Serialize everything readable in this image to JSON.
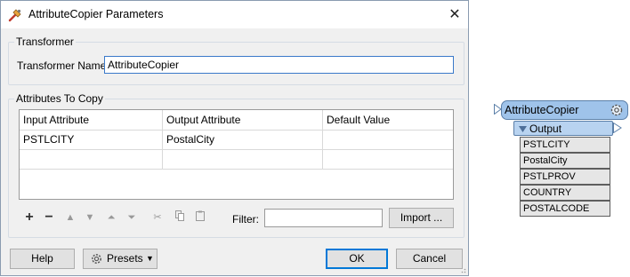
{
  "dialog": {
    "title": "AttributeCopier Parameters",
    "close_symbol": "✕",
    "transformer_group": {
      "label": "Transformer",
      "name_label": "Transformer Name:",
      "name_value": "AttributeCopier"
    },
    "attributes_group": {
      "label": "Attributes To Copy",
      "columns": [
        "Input Attribute",
        "Output Attribute",
        "Default Value"
      ],
      "rows": [
        [
          "PSTLCITY",
          "PostalCity",
          ""
        ],
        [
          "",
          "",
          ""
        ]
      ]
    },
    "toolbar": {
      "icons": [
        "add-icon",
        "remove-icon",
        "move-up-icon",
        "move-down-icon",
        "move-top-icon",
        "move-bottom-icon",
        "cut-icon",
        "copy-icon",
        "paste-icon"
      ],
      "filter_label": "Filter:",
      "filter_value": "",
      "import_label": "Import ..."
    },
    "buttons": {
      "help": "Help",
      "presets": "Presets",
      "ok": "OK",
      "cancel": "Cancel"
    }
  },
  "workspace": {
    "transformer": {
      "name": "AttributeCopier",
      "output_port": "Output",
      "attributes": [
        "PSTLCITY",
        "PostalCity",
        "PSTLPROV",
        "COUNTRY",
        "POSTALCODE"
      ],
      "colors": {
        "header": "#9fc3ea",
        "port": "#b8d3f0",
        "attribute": "#e6e6e6"
      }
    }
  }
}
